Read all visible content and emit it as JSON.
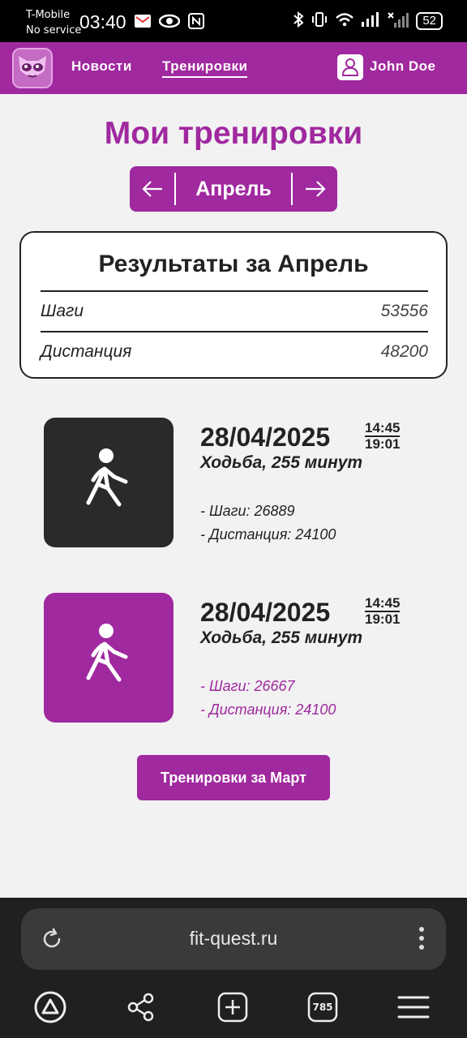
{
  "status_bar": {
    "carrier": "T-Mobile",
    "service": "No service",
    "time": "03:40",
    "battery": "52"
  },
  "nav": {
    "links": [
      "Новости",
      "Тренировки"
    ],
    "user_name": "John Doe"
  },
  "page": {
    "title": "Мои тренировки",
    "month": "Апрель"
  },
  "results": {
    "title": "Результаты за Апрель",
    "rows": [
      {
        "label": "Шаги",
        "value": "53556"
      },
      {
        "label": "Дистанция",
        "value": "48200"
      }
    ]
  },
  "workouts": [
    {
      "date": "28/04/2025",
      "start": "14:45",
      "end": "19:01",
      "type": "Ходьба, 255 минут",
      "steps": "- Шаги: 26889",
      "distance": "- Дистанция: 24100",
      "icon": "walking-icon"
    },
    {
      "date": "28/04/2025",
      "start": "14:45",
      "end": "19:01",
      "type": "Ходьба, 255 минут",
      "steps": "- Шаги: 26667",
      "distance": "- Дистанция: 24100",
      "icon": "walking-icon"
    }
  ],
  "prev_button": "Тренировки за Март",
  "browser": {
    "url": "fit-quest.ru",
    "tabs_count": "785"
  },
  "colors": {
    "accent": "#a0299f",
    "dark_tile": "#2a2a2a"
  }
}
